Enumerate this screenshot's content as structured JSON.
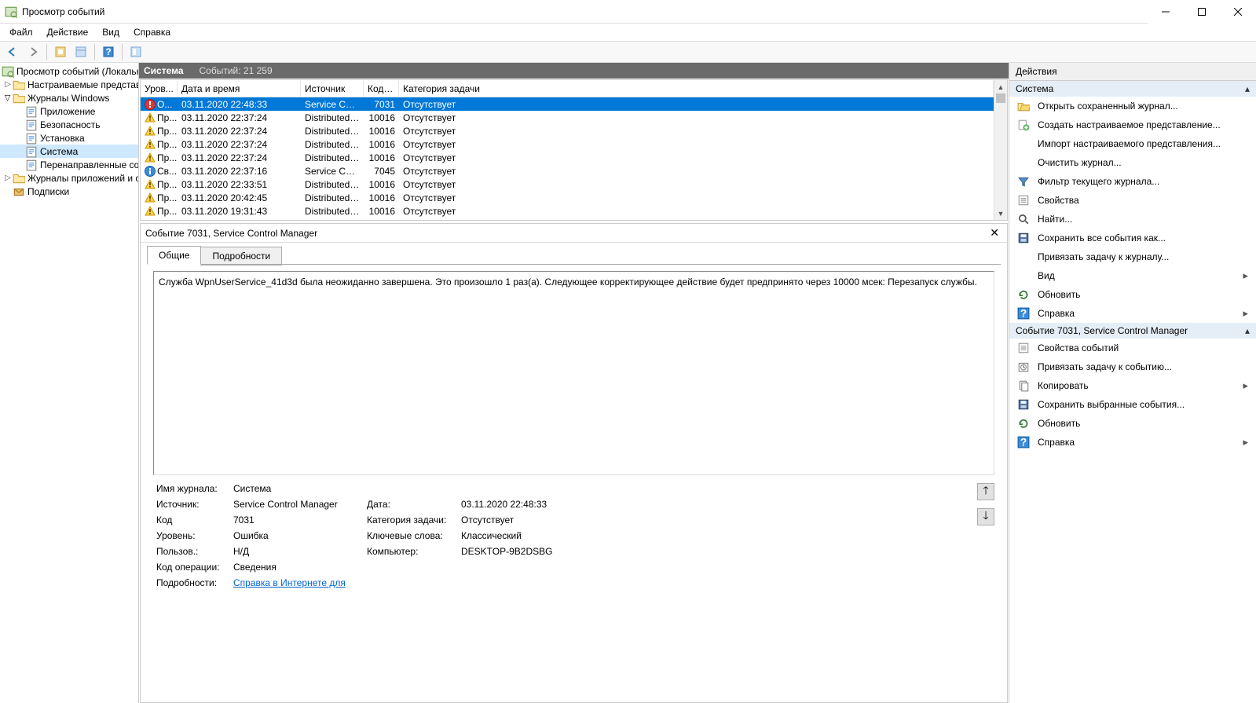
{
  "window": {
    "title": "Просмотр событий"
  },
  "menu": {
    "file": "Файл",
    "action": "Действие",
    "view": "Вид",
    "help": "Справка"
  },
  "tree": {
    "root": "Просмотр событий (Локальны",
    "custom": "Настраиваемые представл",
    "winlogs": "Журналы Windows",
    "app": "Приложение",
    "security": "Безопасность",
    "setup": "Установка",
    "system": "Система",
    "forwarded": "Перенаправленные соб",
    "applogs": "Журналы приложений и сл",
    "subs": "Подписки"
  },
  "center": {
    "title": "Система",
    "count_label": "Событий: 21 259",
    "columns": {
      "level": "Уров...",
      "date": "Дата и время",
      "source": "Источник",
      "code": "Код с...",
      "category": "Категория задачи"
    },
    "rows": [
      {
        "icon": "error",
        "level": "О...",
        "date": "03.11.2020 22:48:33",
        "source": "Service Cont...",
        "code": "7031",
        "category": "Отсутствует",
        "selected": true
      },
      {
        "icon": "warn",
        "level": "Пр...",
        "date": "03.11.2020 22:37:24",
        "source": "DistributedC...",
        "code": "10016",
        "category": "Отсутствует"
      },
      {
        "icon": "warn",
        "level": "Пр...",
        "date": "03.11.2020 22:37:24",
        "source": "DistributedC...",
        "code": "10016",
        "category": "Отсутствует"
      },
      {
        "icon": "warn",
        "level": "Пр...",
        "date": "03.11.2020 22:37:24",
        "source": "DistributedC...",
        "code": "10016",
        "category": "Отсутствует"
      },
      {
        "icon": "warn",
        "level": "Пр...",
        "date": "03.11.2020 22:37:24",
        "source": "DistributedC...",
        "code": "10016",
        "category": "Отсутствует"
      },
      {
        "icon": "info",
        "level": "Св...",
        "date": "03.11.2020 22:37:16",
        "source": "Service Cont...",
        "code": "7045",
        "category": "Отсутствует"
      },
      {
        "icon": "warn",
        "level": "Пр...",
        "date": "03.11.2020 22:33:51",
        "source": "DistributedC...",
        "code": "10016",
        "category": "Отсутствует"
      },
      {
        "icon": "warn",
        "level": "Пр...",
        "date": "03.11.2020 20:42:45",
        "source": "DistributedC...",
        "code": "10016",
        "category": "Отсутствует"
      },
      {
        "icon": "warn",
        "level": "Пр...",
        "date": "03.11.2020 19:31:43",
        "source": "DistributedC...",
        "code": "10016",
        "category": "Отсутствует"
      }
    ]
  },
  "detail": {
    "header": "Событие 7031, Service Control Manager",
    "tabs": {
      "general": "Общие",
      "details": "Подробности"
    },
    "description": "Служба WpnUserService_41d3d была неожиданно завершена. Это произошло 1 раз(а). Следующее корректирующее действие будет предпринято через 10000 мсек: Перезапуск службы.",
    "labels": {
      "logname": "Имя журнала:",
      "source": "Источник:",
      "date": "Дата:",
      "code": "Код",
      "category": "Категория задачи:",
      "level": "Уровень:",
      "keywords": "Ключевые слова:",
      "user": "Пользов.:",
      "computer": "Компьютер:",
      "opcode": "Код операции:",
      "more": "Подробности:"
    },
    "values": {
      "logname": "Система",
      "source": "Service Control Manager",
      "date": "03.11.2020 22:48:33",
      "code": "7031",
      "category": "Отсутствует",
      "level": "Ошибка",
      "keywords": "Классический",
      "user": "Н/Д",
      "computer": "DESKTOP-9B2DSBG",
      "opcode": "Сведения",
      "link": "Справка в Интернете для "
    }
  },
  "actions": {
    "title": "Действия",
    "section1": "Система",
    "items1": [
      {
        "icon": "open",
        "label": "Открыть сохраненный журнал..."
      },
      {
        "icon": "create",
        "label": "Создать настраиваемое представление..."
      },
      {
        "icon": "none",
        "label": "Импорт настраиваемого представления..."
      },
      {
        "icon": "none",
        "label": "Очистить журнал..."
      },
      {
        "icon": "filter",
        "label": "Фильтр текущего журнала..."
      },
      {
        "icon": "props",
        "label": "Свойства"
      },
      {
        "icon": "find",
        "label": "Найти..."
      },
      {
        "icon": "save",
        "label": "Сохранить все события как..."
      },
      {
        "icon": "none",
        "label": "Привязать задачу к журналу..."
      },
      {
        "icon": "none",
        "label": "Вид",
        "submenu": true
      },
      {
        "icon": "refresh",
        "label": "Обновить"
      },
      {
        "icon": "help",
        "label": "Справка",
        "submenu": true
      }
    ],
    "section2": "Событие 7031, Service Control Manager",
    "items2": [
      {
        "icon": "props",
        "label": "Свойства событий"
      },
      {
        "icon": "task",
        "label": "Привязать задачу к событию..."
      },
      {
        "icon": "copy",
        "label": "Копировать",
        "submenu": true
      },
      {
        "icon": "save",
        "label": "Сохранить выбранные события..."
      },
      {
        "icon": "refresh",
        "label": "Обновить"
      },
      {
        "icon": "help",
        "label": "Справка",
        "submenu": true
      }
    ]
  }
}
